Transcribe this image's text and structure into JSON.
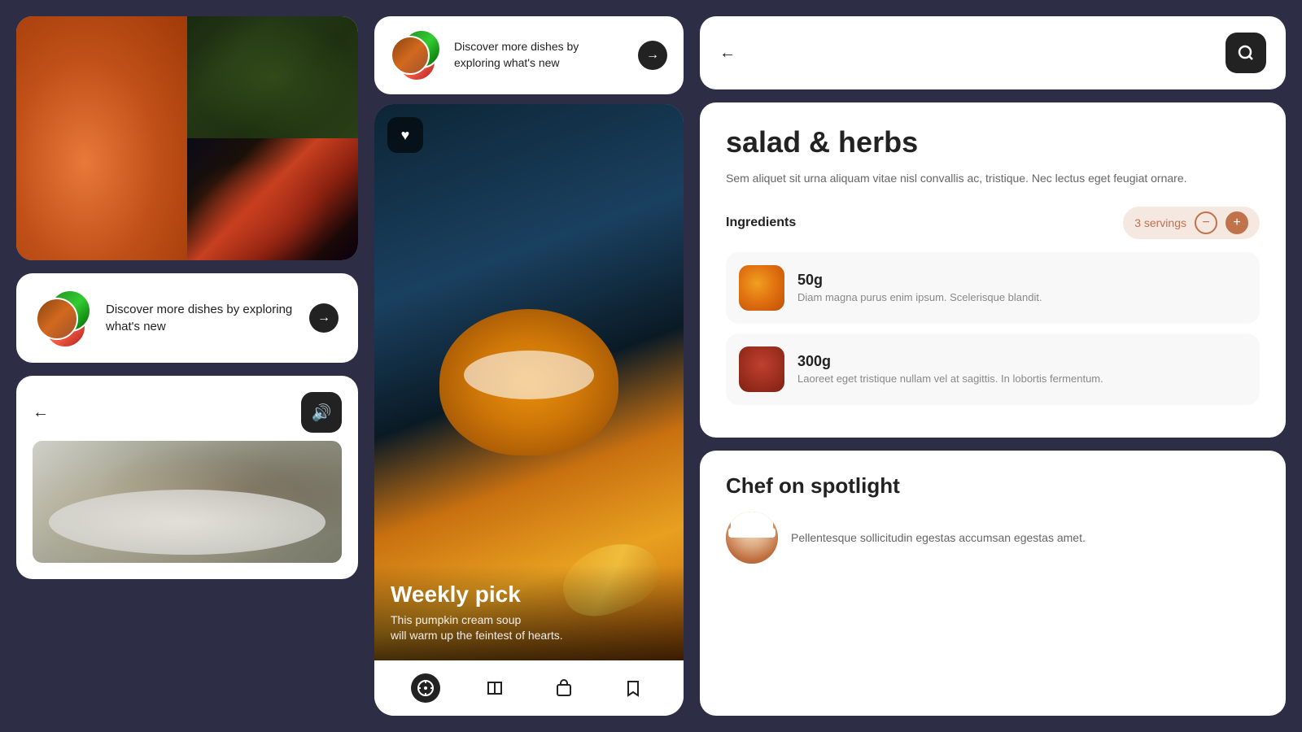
{
  "app": {
    "background_color": "#2d2d45"
  },
  "left_panel": {
    "discover_card": {
      "text": "Discover more dishes by exploring what's new",
      "arrow": "→"
    },
    "bottom_card": {
      "back_icon": "←",
      "sound_icon": "🔊"
    }
  },
  "center_panel": {
    "discover_card": {
      "text": "Discover more dishes by exploring what's new",
      "arrow": "→"
    },
    "main_card": {
      "weekly_pick_label": "Weekly pick",
      "weekly_pick_desc": "This pumpkin cream soup\nwill warm up the feintest of hearts.",
      "heart_icon": "♥",
      "nav": {
        "compass_icon": "⊙",
        "book_icon": "📖",
        "bag_icon": "🛍",
        "bookmark_icon": "🔖"
      }
    }
  },
  "right_panel": {
    "recipe_card": {
      "title": "salad & herbs",
      "description": "Sem aliquet sit urna aliquam vitae nisl convallis ac, tristique. Nec lectus eget feugiat ornare.",
      "ingredients_label": "Ingredients",
      "servings": "3 servings",
      "minus_label": "−",
      "plus_label": "+",
      "ingredients": [
        {
          "amount": "50g",
          "description": "Diam magna purus enim ipsum. Scelerisque blandit.",
          "icon_type": "orange"
        },
        {
          "amount": "300g",
          "description": "Laoreet eget tristique nullam vel at sagittis. In lobortis fermentum.",
          "icon_type": "octopus"
        }
      ]
    },
    "chef_card": {
      "title": "Chef on spotlight",
      "description": "Pellentesque sollicitudin egestas accumsan egestas amet."
    },
    "search_card": {
      "back_icon": "←",
      "search_icon": "🔍"
    }
  }
}
